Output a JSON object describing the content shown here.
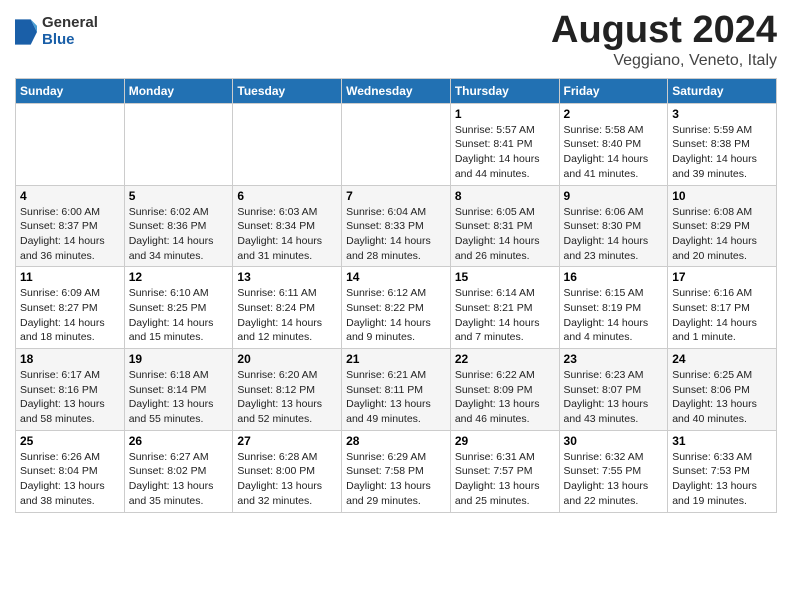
{
  "header": {
    "logo_general": "General",
    "logo_blue": "Blue",
    "title": "August 2024",
    "subtitle": "Veggiano, Veneto, Italy"
  },
  "days_of_week": [
    "Sunday",
    "Monday",
    "Tuesday",
    "Wednesday",
    "Thursday",
    "Friday",
    "Saturday"
  ],
  "weeks": [
    [
      {
        "day": "",
        "info": ""
      },
      {
        "day": "",
        "info": ""
      },
      {
        "day": "",
        "info": ""
      },
      {
        "day": "",
        "info": ""
      },
      {
        "day": "1",
        "info": "Sunrise: 5:57 AM\nSunset: 8:41 PM\nDaylight: 14 hours\nand 44 minutes."
      },
      {
        "day": "2",
        "info": "Sunrise: 5:58 AM\nSunset: 8:40 PM\nDaylight: 14 hours\nand 41 minutes."
      },
      {
        "day": "3",
        "info": "Sunrise: 5:59 AM\nSunset: 8:38 PM\nDaylight: 14 hours\nand 39 minutes."
      }
    ],
    [
      {
        "day": "4",
        "info": "Sunrise: 6:00 AM\nSunset: 8:37 PM\nDaylight: 14 hours\nand 36 minutes."
      },
      {
        "day": "5",
        "info": "Sunrise: 6:02 AM\nSunset: 8:36 PM\nDaylight: 14 hours\nand 34 minutes."
      },
      {
        "day": "6",
        "info": "Sunrise: 6:03 AM\nSunset: 8:34 PM\nDaylight: 14 hours\nand 31 minutes."
      },
      {
        "day": "7",
        "info": "Sunrise: 6:04 AM\nSunset: 8:33 PM\nDaylight: 14 hours\nand 28 minutes."
      },
      {
        "day": "8",
        "info": "Sunrise: 6:05 AM\nSunset: 8:31 PM\nDaylight: 14 hours\nand 26 minutes."
      },
      {
        "day": "9",
        "info": "Sunrise: 6:06 AM\nSunset: 8:30 PM\nDaylight: 14 hours\nand 23 minutes."
      },
      {
        "day": "10",
        "info": "Sunrise: 6:08 AM\nSunset: 8:29 PM\nDaylight: 14 hours\nand 20 minutes."
      }
    ],
    [
      {
        "day": "11",
        "info": "Sunrise: 6:09 AM\nSunset: 8:27 PM\nDaylight: 14 hours\nand 18 minutes."
      },
      {
        "day": "12",
        "info": "Sunrise: 6:10 AM\nSunset: 8:25 PM\nDaylight: 14 hours\nand 15 minutes."
      },
      {
        "day": "13",
        "info": "Sunrise: 6:11 AM\nSunset: 8:24 PM\nDaylight: 14 hours\nand 12 minutes."
      },
      {
        "day": "14",
        "info": "Sunrise: 6:12 AM\nSunset: 8:22 PM\nDaylight: 14 hours\nand 9 minutes."
      },
      {
        "day": "15",
        "info": "Sunrise: 6:14 AM\nSunset: 8:21 PM\nDaylight: 14 hours\nand 7 minutes."
      },
      {
        "day": "16",
        "info": "Sunrise: 6:15 AM\nSunset: 8:19 PM\nDaylight: 14 hours\nand 4 minutes."
      },
      {
        "day": "17",
        "info": "Sunrise: 6:16 AM\nSunset: 8:17 PM\nDaylight: 14 hours\nand 1 minute."
      }
    ],
    [
      {
        "day": "18",
        "info": "Sunrise: 6:17 AM\nSunset: 8:16 PM\nDaylight: 13 hours\nand 58 minutes."
      },
      {
        "day": "19",
        "info": "Sunrise: 6:18 AM\nSunset: 8:14 PM\nDaylight: 13 hours\nand 55 minutes."
      },
      {
        "day": "20",
        "info": "Sunrise: 6:20 AM\nSunset: 8:12 PM\nDaylight: 13 hours\nand 52 minutes."
      },
      {
        "day": "21",
        "info": "Sunrise: 6:21 AM\nSunset: 8:11 PM\nDaylight: 13 hours\nand 49 minutes."
      },
      {
        "day": "22",
        "info": "Sunrise: 6:22 AM\nSunset: 8:09 PM\nDaylight: 13 hours\nand 46 minutes."
      },
      {
        "day": "23",
        "info": "Sunrise: 6:23 AM\nSunset: 8:07 PM\nDaylight: 13 hours\nand 43 minutes."
      },
      {
        "day": "24",
        "info": "Sunrise: 6:25 AM\nSunset: 8:06 PM\nDaylight: 13 hours\nand 40 minutes."
      }
    ],
    [
      {
        "day": "25",
        "info": "Sunrise: 6:26 AM\nSunset: 8:04 PM\nDaylight: 13 hours\nand 38 minutes."
      },
      {
        "day": "26",
        "info": "Sunrise: 6:27 AM\nSunset: 8:02 PM\nDaylight: 13 hours\nand 35 minutes."
      },
      {
        "day": "27",
        "info": "Sunrise: 6:28 AM\nSunset: 8:00 PM\nDaylight: 13 hours\nand 32 minutes."
      },
      {
        "day": "28",
        "info": "Sunrise: 6:29 AM\nSunset: 7:58 PM\nDaylight: 13 hours\nand 29 minutes."
      },
      {
        "day": "29",
        "info": "Sunrise: 6:31 AM\nSunset: 7:57 PM\nDaylight: 13 hours\nand 25 minutes."
      },
      {
        "day": "30",
        "info": "Sunrise: 6:32 AM\nSunset: 7:55 PM\nDaylight: 13 hours\nand 22 minutes."
      },
      {
        "day": "31",
        "info": "Sunrise: 6:33 AM\nSunset: 7:53 PM\nDaylight: 13 hours\nand 19 minutes."
      }
    ]
  ]
}
